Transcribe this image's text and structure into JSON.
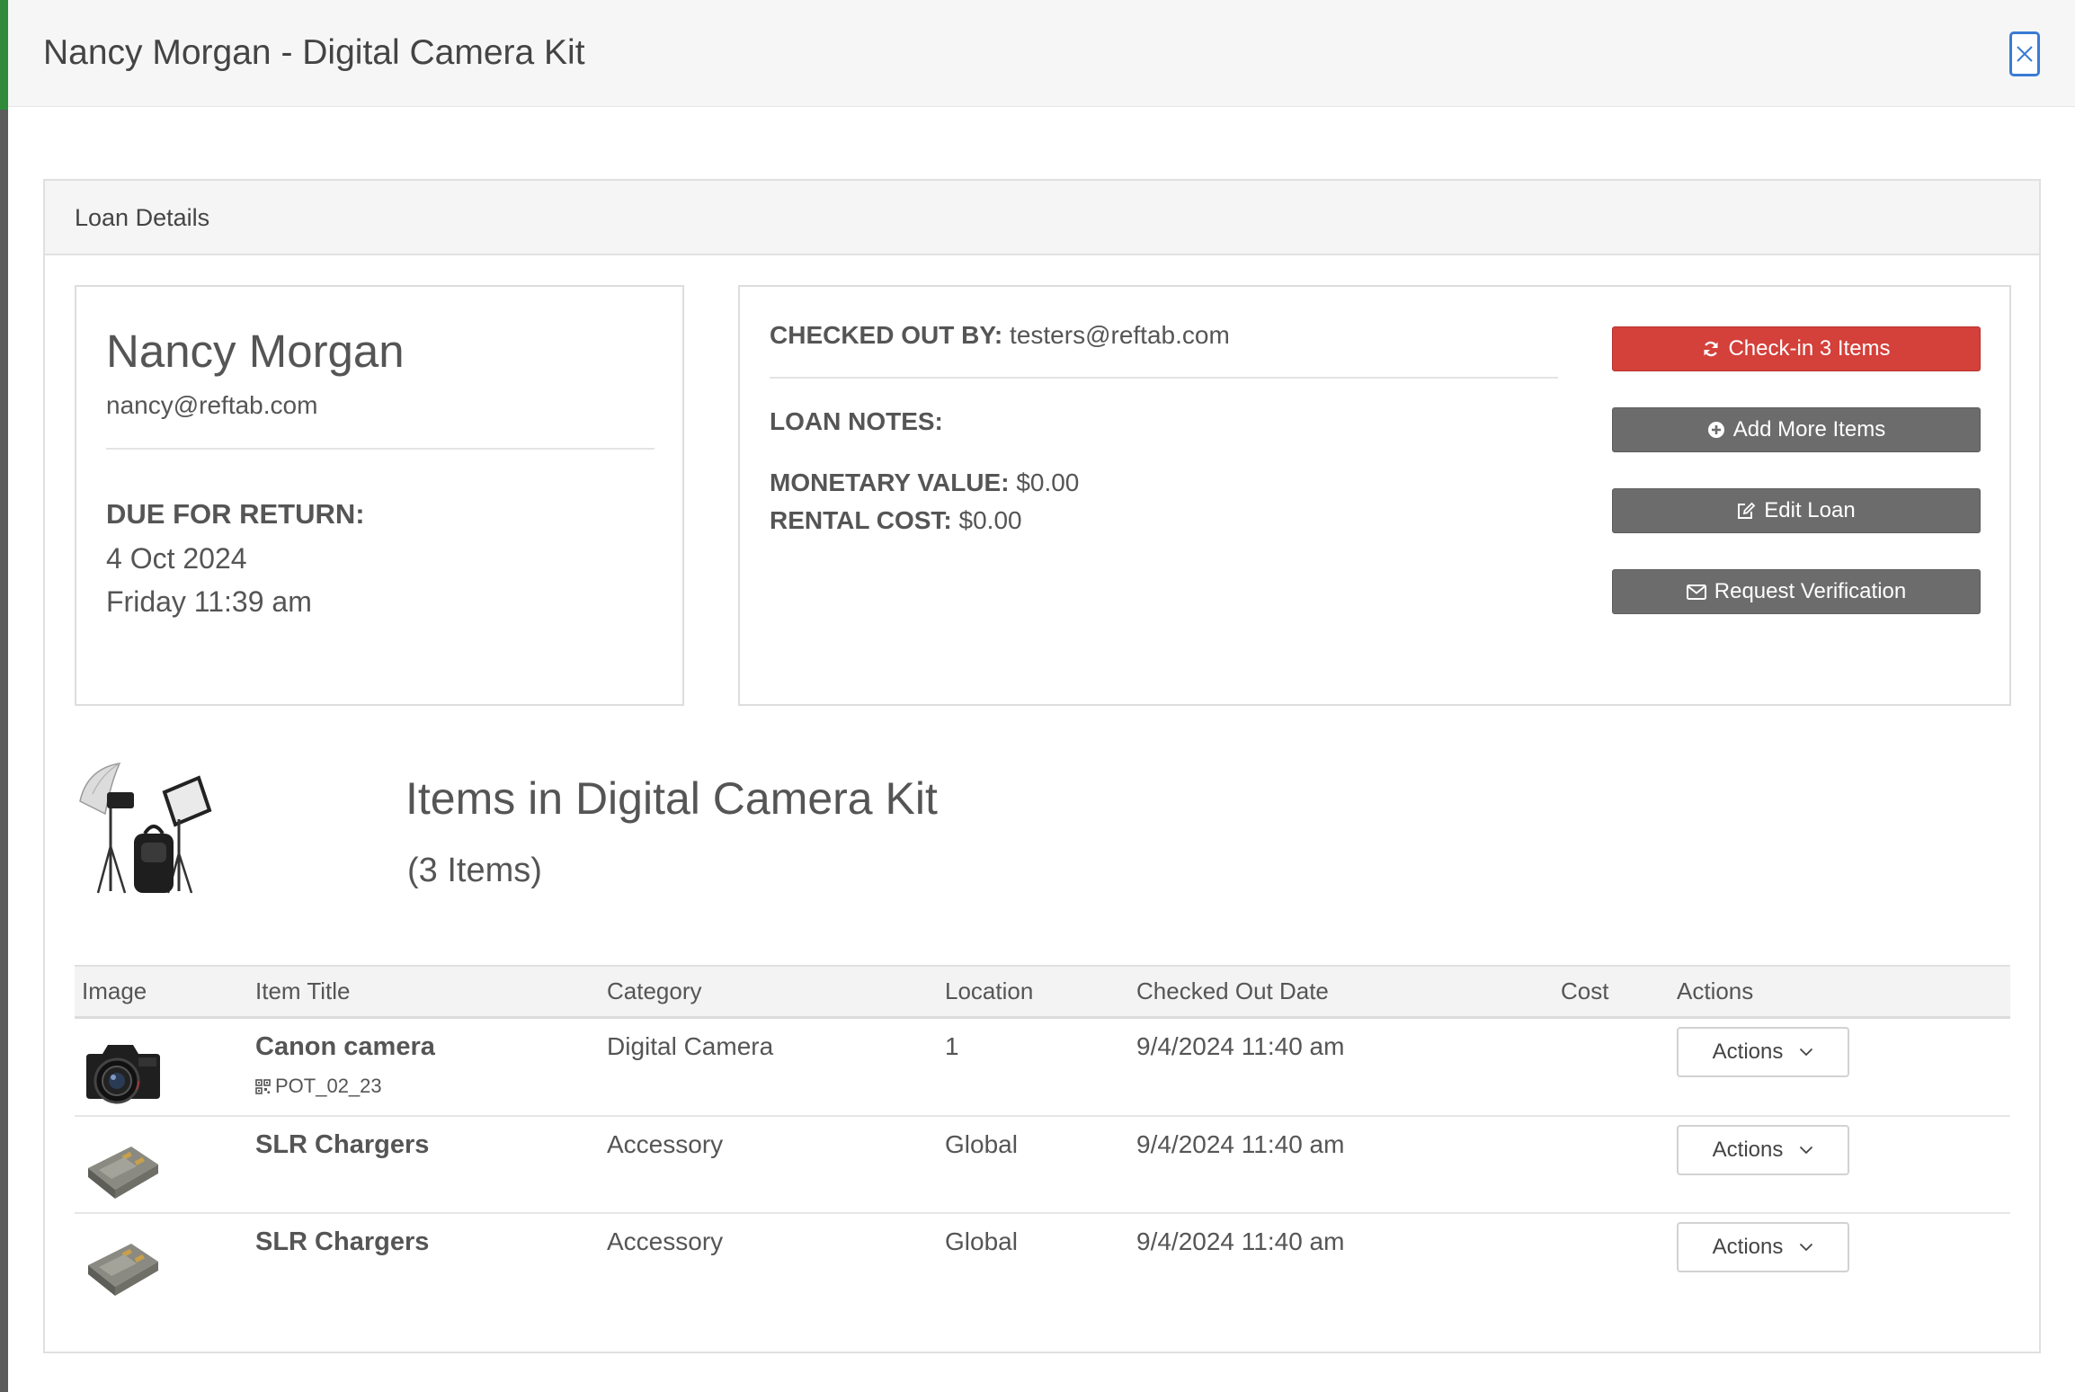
{
  "modal": {
    "title": "Nancy Morgan - Digital Camera Kit",
    "close_icon": "close-icon"
  },
  "panel": {
    "heading": "Loan Details"
  },
  "borrower": {
    "name": "Nancy Morgan",
    "email": "nancy@reftab.com",
    "due_label": "DUE FOR RETURN:",
    "due_date": "4 Oct 2024",
    "due_time": "Friday 11:39 am"
  },
  "loan": {
    "checked_out_by_label": "CHECKED OUT BY:",
    "checked_out_by_value": "testers@reftab.com",
    "notes_label": "LOAN NOTES:",
    "notes_value": "",
    "monetary_label": "MONETARY VALUE:",
    "monetary_value": "$0.00",
    "rental_label": "RENTAL COST:",
    "rental_value": "$0.00"
  },
  "buttons": {
    "checkin": "Check-in 3 Items",
    "add_more": "Add More Items",
    "edit": "Edit Loan",
    "request_verification": "Request Verification"
  },
  "kit": {
    "title": "Items in Digital Camera Kit",
    "count": "(3 Items)"
  },
  "table": {
    "columns": [
      "Image",
      "Item Title",
      "Category",
      "Location",
      "Checked Out Date",
      "Cost",
      "Actions"
    ],
    "rows": [
      {
        "image": "camera-image",
        "title": "Canon camera",
        "tag": "POT_02_23",
        "category": "Digital Camera",
        "location": "1",
        "checked_out": "9/4/2024 11:40 am",
        "cost": "",
        "action_label": "Actions"
      },
      {
        "image": "battery-image",
        "title": "SLR Chargers",
        "tag": "",
        "category": "Accessory",
        "location": "Global",
        "checked_out": "9/4/2024 11:40 am",
        "cost": "",
        "action_label": "Actions"
      },
      {
        "image": "battery-image",
        "title": "SLR Chargers",
        "tag": "",
        "category": "Accessory",
        "location": "Global",
        "checked_out": "9/4/2024 11:40 am",
        "cost": "",
        "action_label": "Actions"
      }
    ]
  },
  "colors": {
    "danger": "#d4403a",
    "secondary": "#6c6c6c",
    "close_accent": "#3a7bd5"
  }
}
